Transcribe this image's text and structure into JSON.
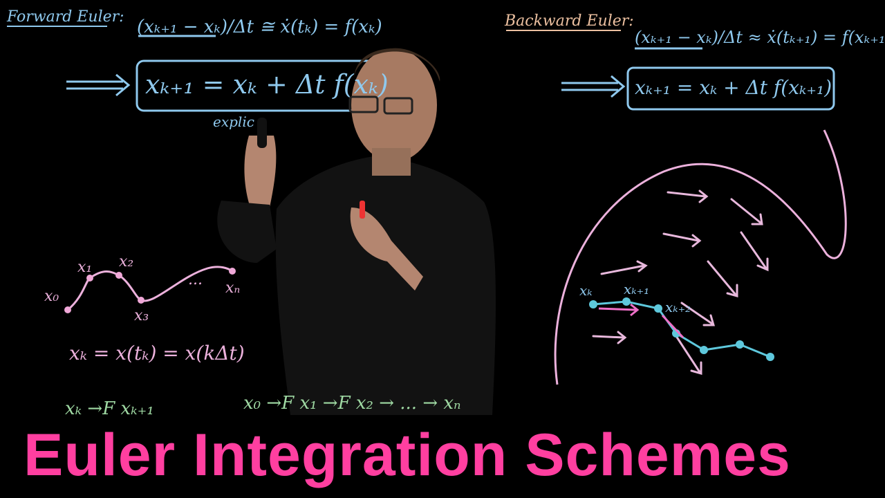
{
  "colors": {
    "background": "#000000",
    "blue_ink": "#8fc9ee",
    "pink_ink": "#ecb1dc",
    "green_ink": "#9fd9a3",
    "cyan_points": "#5ec8dc",
    "title_pink": "#ff3fa0"
  },
  "board": {
    "forward_label": "Forward Euler:",
    "forward_derivative": "(xₖ₊₁ − xₖ)/Δt ≅ ẋ(tₖ) = f(xₖ)",
    "forward_update": "xₖ₊₁ = xₖ + Δt f(xₖ)",
    "explicit_label": "explic",
    "backward_label": "Backward Euler:",
    "backward_derivative": "(xₖ₊₁ − xₖ)/Δt ≈ ẋ(tₖ₊₁) = f(xₖ₊₁)",
    "backward_update": "xₖ₊₁ = xₖ + Δt f(xₖ₊₁)",
    "traj_labels": [
      "x₀",
      "x₁",
      "x₂",
      "x₃",
      "...",
      "xₙ"
    ],
    "state_definition": "xₖ = x(tₖ) = x(kΔt)",
    "map_single": "xₖ →F xₖ₊₁",
    "map_chain": "x₀ →F x₁ →F x₂ → ... → xₙ",
    "flow_labels": [
      "xₖ",
      "xₖ₊₁",
      "xₖ₊₂"
    ]
  },
  "title": "Euler Integration Schemes"
}
